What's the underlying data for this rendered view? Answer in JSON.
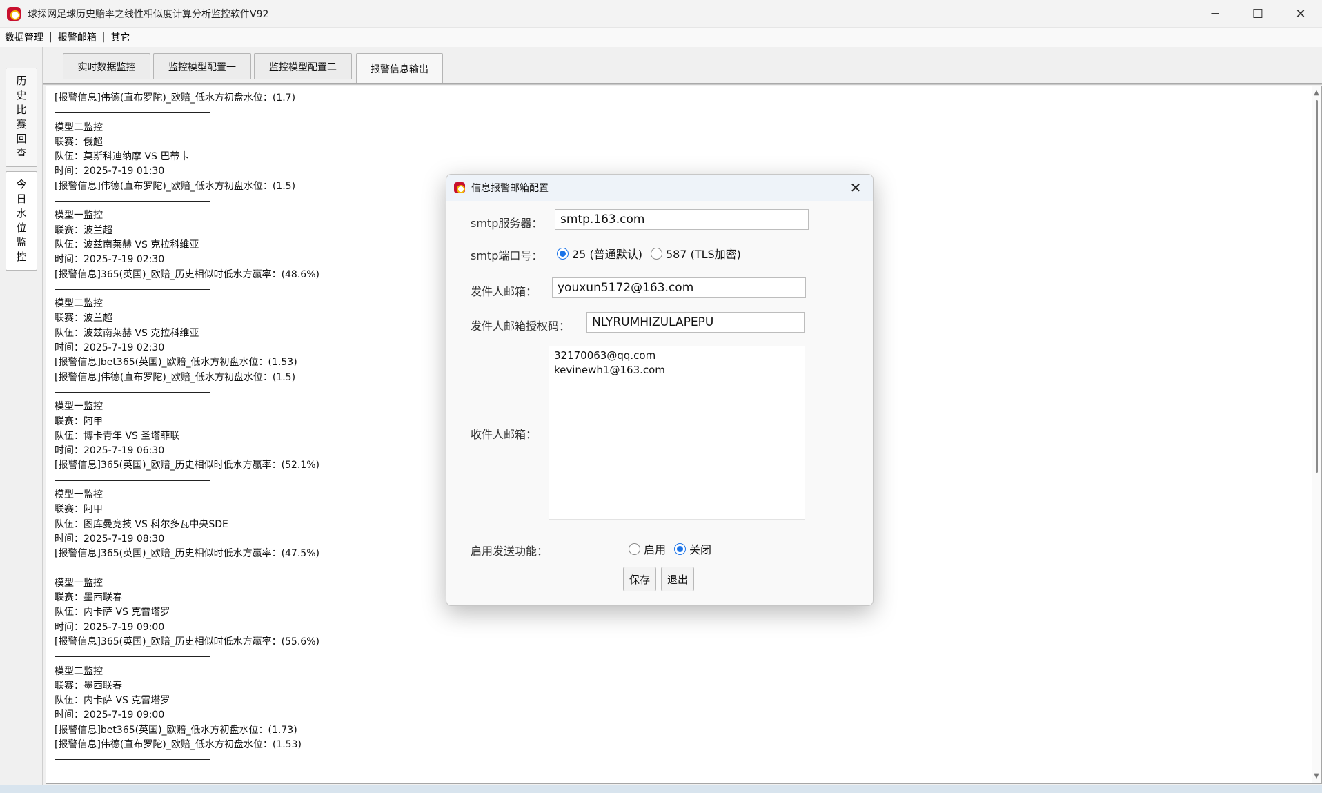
{
  "window": {
    "title": "球探网足球历史赔率之线性相似度计算分析监控软件V92",
    "minimize_glyph": "─",
    "maximize_glyph": "☐",
    "close_glyph": "✕"
  },
  "menu": {
    "items": [
      "数据管理",
      "报警邮箱",
      "其它"
    ],
    "separator": "|"
  },
  "side_tabs": [
    {
      "label_chars": [
        "历",
        "史",
        "比",
        "赛",
        "回",
        "查"
      ]
    },
    {
      "label_chars": [
        "今",
        "日",
        "水",
        "位",
        "监",
        "控"
      ]
    }
  ],
  "tabs": [
    {
      "label": "实时数据监控"
    },
    {
      "label": "监控模型配置一"
    },
    {
      "label": "监控模型配置二"
    },
    {
      "label": "报警信息输出"
    }
  ],
  "log": {
    "lines": [
      {
        "type": "text",
        "text": "[报警信息]伟德(直布罗陀)_欧赔_低水方初盘水位：(1.7)"
      },
      {
        "type": "sep"
      },
      {
        "type": "text",
        "text": "模型二监控"
      },
      {
        "type": "text",
        "text": "联赛：俄超"
      },
      {
        "type": "text",
        "text": "队伍：莫斯科迪纳摩 VS 巴蒂卡"
      },
      {
        "type": "text",
        "text": "时间：2025-7-19 01:30"
      },
      {
        "type": "text",
        "text": "[报警信息]伟德(直布罗陀)_欧赔_低水方初盘水位：(1.5)"
      },
      {
        "type": "sep"
      },
      {
        "type": "text",
        "text": "模型一监控"
      },
      {
        "type": "text",
        "text": "联赛：波兰超"
      },
      {
        "type": "text",
        "text": "队伍：波兹南莱赫 VS 克拉科维亚"
      },
      {
        "type": "text",
        "text": "时间：2025-7-19 02:30"
      },
      {
        "type": "text",
        "text": "[报警信息]365(英国)_欧赔_历史相似时低水方赢率：(48.6%)"
      },
      {
        "type": "sep"
      },
      {
        "type": "text",
        "text": "模型二监控"
      },
      {
        "type": "text",
        "text": "联赛：波兰超"
      },
      {
        "type": "text",
        "text": "队伍：波兹南莱赫 VS 克拉科维亚"
      },
      {
        "type": "text",
        "text": "时间：2025-7-19 02:30"
      },
      {
        "type": "text",
        "text": "[报警信息]bet365(英国)_欧赔_低水方初盘水位：(1.53)"
      },
      {
        "type": "text",
        "text": "[报警信息]伟德(直布罗陀)_欧赔_低水方初盘水位：(1.5)"
      },
      {
        "type": "sep"
      },
      {
        "type": "text",
        "text": "模型一监控"
      },
      {
        "type": "text",
        "text": "联赛：阿甲"
      },
      {
        "type": "text",
        "text": "队伍：博卡青年 VS 圣塔菲联"
      },
      {
        "type": "text",
        "text": "时间：2025-7-19 06:30"
      },
      {
        "type": "text",
        "text": "[报警信息]365(英国)_欧赔_历史相似时低水方赢率：(52.1%)"
      },
      {
        "type": "sep"
      },
      {
        "type": "text",
        "text": "模型一监控"
      },
      {
        "type": "text",
        "text": "联赛：阿甲"
      },
      {
        "type": "text",
        "text": "队伍：图库曼竞技 VS 科尔多瓦中央SDE"
      },
      {
        "type": "text",
        "text": "时间：2025-7-19 08:30"
      },
      {
        "type": "text",
        "text": "[报警信息]365(英国)_欧赔_历史相似时低水方赢率：(47.5%)"
      },
      {
        "type": "sep"
      },
      {
        "type": "text",
        "text": "模型一监控"
      },
      {
        "type": "text",
        "text": "联赛：墨西联春"
      },
      {
        "type": "text",
        "text": "队伍：内卡萨 VS 克雷塔罗"
      },
      {
        "type": "text",
        "text": "时间：2025-7-19 09:00"
      },
      {
        "type": "text",
        "text": "[报警信息]365(英国)_欧赔_历史相似时低水方赢率：(55.6%)"
      },
      {
        "type": "sep"
      },
      {
        "type": "text",
        "text": "模型二监控"
      },
      {
        "type": "text",
        "text": "联赛：墨西联春"
      },
      {
        "type": "text",
        "text": "队伍：内卡萨 VS 克雷塔罗"
      },
      {
        "type": "text",
        "text": "时间：2025-7-19 09:00"
      },
      {
        "type": "text",
        "text": "[报警信息]bet365(英国)_欧赔_低水方初盘水位：(1.73)"
      },
      {
        "type": "text",
        "text": "[报警信息]伟德(直布罗陀)_欧赔_低水方初盘水位：(1.53)"
      },
      {
        "type": "sep"
      }
    ]
  },
  "dialog": {
    "title": "信息报警邮箱配置",
    "close_glyph": "✕",
    "smtp_server_label": "smtp服务器：",
    "smtp_server_value": "smtp.163.com",
    "smtp_port_label": "smtp端口号：",
    "port_options": [
      {
        "label": "25 (普通默认)",
        "selected": true
      },
      {
        "label": "587 (TLS加密)",
        "selected": false
      }
    ],
    "sender_label": "发件人邮箱：",
    "sender_value": "youxun5172@163.com",
    "auth_label": "发件人邮箱授权码：",
    "auth_value": "NLYRUMHIZULAPEPU",
    "recipients_label": "收件人邮箱：",
    "recipients": [
      "32170063@qq.com",
      "kevinewh1@163.com"
    ],
    "enable_label": "启用发送功能：",
    "enable_options": [
      {
        "label": "启用",
        "selected": false
      },
      {
        "label": "关闭",
        "selected": true
      }
    ],
    "save_label": "保存",
    "exit_label": "退出"
  },
  "colors": {
    "accent": "#1a73e8",
    "dialog_title_bg": "#eef3f9",
    "app_icon": "#c8102e"
  }
}
